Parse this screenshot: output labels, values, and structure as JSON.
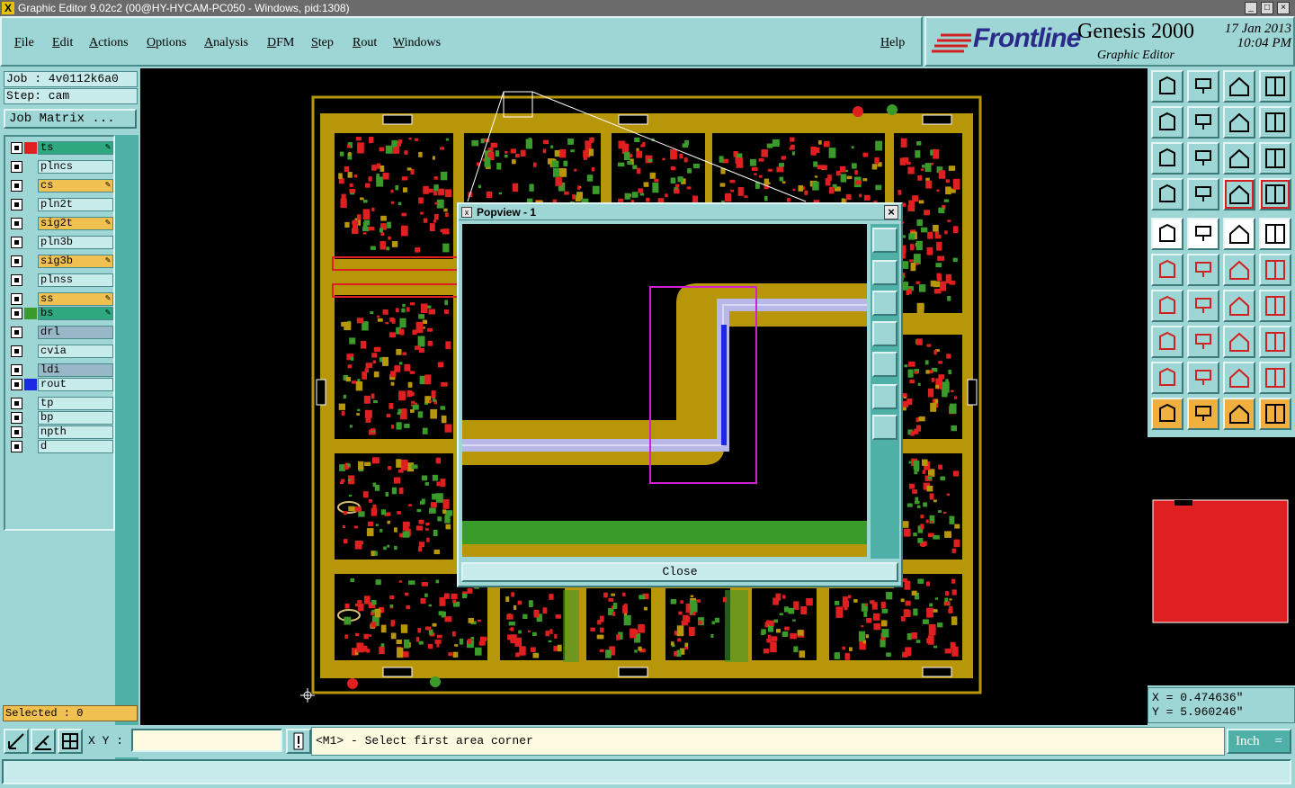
{
  "window": {
    "title": "Graphic Editor 9.02c2 (00@HY-HYCAM-PC050 - Windows, pid:1308)"
  },
  "menu": [
    "File",
    "Edit",
    "Actions",
    "Options",
    "Analysis",
    "DFM",
    "Step",
    "Rout",
    "Windows",
    "Help"
  ],
  "logo": {
    "brand": "Frontline",
    "product": "Genesis 2000",
    "subtitle": "Graphic Editor",
    "date": "17 Jan 2013",
    "time": "10:04 PM"
  },
  "job": {
    "job_label": "Job : 4v0112k6a0",
    "step_label": "Step: cam",
    "matrix_button": "Job Matrix ..."
  },
  "layers": [
    {
      "name": "ts",
      "color": "#e02020",
      "bg": "#2fa880",
      "editable": true
    },
    {
      "name": "plncs",
      "color": "",
      "bg": "#c8ecec",
      "editable": false
    },
    {
      "name": "cs",
      "color": "",
      "bg": "#f0c050",
      "editable": true
    },
    {
      "name": "pln2t",
      "color": "",
      "bg": "#c8ecec",
      "editable": false
    },
    {
      "name": "sig2t",
      "color": "",
      "bg": "#f0c050",
      "editable": true
    },
    {
      "name": "pln3b",
      "color": "",
      "bg": "#c8ecec",
      "editable": false
    },
    {
      "name": "sig3b",
      "color": "",
      "bg": "#f0c050",
      "editable": true
    },
    {
      "name": "plnss",
      "color": "",
      "bg": "#c8ecec",
      "editable": false
    },
    {
      "name": "ss",
      "color": "",
      "bg": "#f0c050",
      "editable": true
    },
    {
      "name": "bs",
      "color": "#3a9a2a",
      "bg": "#2fa880",
      "editable": true
    },
    {
      "name": "drl",
      "color": "",
      "bg": "#98b8c8",
      "editable": false
    },
    {
      "name": "cvia",
      "color": "",
      "bg": "#c8ecec",
      "editable": false
    },
    {
      "name": "ldi",
      "color": "",
      "bg": "#98b8c8",
      "editable": false
    },
    {
      "name": "rout",
      "color": "#1a2ae0",
      "bg": "#c8ecec",
      "editable": false
    },
    {
      "name": "tp",
      "color": "",
      "bg": "#c8ecec",
      "editable": false
    },
    {
      "name": "bp",
      "color": "",
      "bg": "#c8ecec",
      "editable": false
    },
    {
      "name": "npth",
      "color": "",
      "bg": "#c8ecec",
      "editable": false
    },
    {
      "name": "d",
      "color": "",
      "bg": "#c8ecec",
      "editable": false
    }
  ],
  "selected_label": "Selected : 0",
  "popview": {
    "title": "Popview - 1",
    "close_label": "Close"
  },
  "coords": {
    "x": "X = 0.474636\"",
    "y": "Y = 5.960246\""
  },
  "bottom": {
    "xy_label": "X Y :",
    "xy_value": "",
    "prompt": "<M1> - Select first area corner",
    "unit": "Inch"
  },
  "colors": {
    "copper": "#b8960a",
    "pad_red": "#e02020",
    "pad_green": "#3a9a2a",
    "rout_blue": "#1a2ae0",
    "selection": "#d020d0"
  }
}
